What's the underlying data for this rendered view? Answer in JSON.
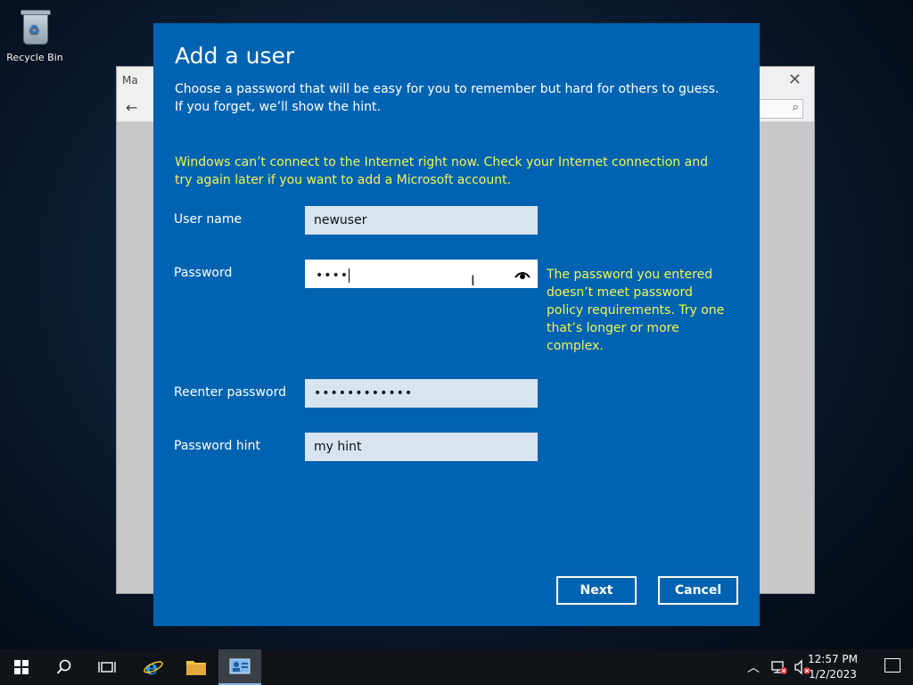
{
  "desktop": {
    "recycle_bin_label": "Recycle Bin"
  },
  "background_window": {
    "title_fragment": "Ma",
    "back_icon": "arrow-left-icon",
    "search_icon": "search-icon",
    "close_icon": "close-icon"
  },
  "dialog": {
    "title": "Add a user",
    "description": "Choose a password that will be easy for you to remember but hard for others to guess. If you forget, we’ll show the hint.",
    "warning": "Windows can’t connect to the Internet right now. Check your Internet connection and try again later if you want to add a Microsoft account.",
    "fields": {
      "username": {
        "label": "User name",
        "value": "newuser"
      },
      "password": {
        "label": "Password",
        "value": "••••"
      },
      "reenter": {
        "label": "Reenter password",
        "value": "••••••••••••"
      },
      "hint": {
        "label": "Password hint",
        "value": "my hint"
      }
    },
    "password_error": "The password you entered doesn’t meet password policy requirements. Try one that’s longer or more complex.",
    "buttons": {
      "next": "Next",
      "cancel": "Cancel"
    },
    "colors": {
      "background": "#0063b1",
      "warning_text": "#f2f556"
    }
  },
  "taskbar": {
    "icons": [
      "windows-start-icon",
      "search-icon",
      "task-view-icon",
      "internet-explorer-icon",
      "file-explorer-icon",
      "user-accounts-icon"
    ],
    "tray_icons": [
      "chevron-up-icon",
      "network-disconnected-icon",
      "volume-muted-icon"
    ],
    "time": "12:57 PM",
    "date": "1/2/2023"
  }
}
